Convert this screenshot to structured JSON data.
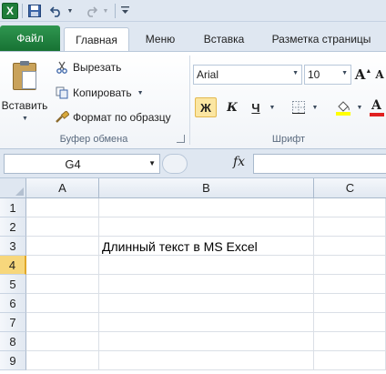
{
  "quick_access": {
    "app_logo_letter": "X",
    "save_icon": "save-icon",
    "undo_icon": "undo-icon",
    "redo_icon": "redo-icon",
    "customize_icon": "customize-qat-icon"
  },
  "tabs": [
    {
      "label": "Файл"
    },
    {
      "label": "Главная"
    },
    {
      "label": "Меню"
    },
    {
      "label": "Вставка"
    },
    {
      "label": "Разметка страницы"
    }
  ],
  "clipboard": {
    "paste_label": "Вставить",
    "cut_label": "Вырезать",
    "copy_label": "Копировать",
    "format_painter_label": "Формат по образцу",
    "group_label": "Буфер обмена"
  },
  "font": {
    "family": "Arial",
    "size": "10",
    "bold_label": "Ж",
    "italic_label": "К",
    "underline_label": "Ч",
    "grow_label": "A",
    "shrink_label": "A",
    "font_color_label": "A",
    "group_label": "Шрифт",
    "bold_active": true
  },
  "formula_bar": {
    "name_box": "G4",
    "fx_label": "fx",
    "formula": ""
  },
  "grid": {
    "columns": [
      "A",
      "B",
      "C"
    ],
    "rows": [
      "1",
      "2",
      "3",
      "4",
      "5",
      "6",
      "7",
      "8",
      "9"
    ],
    "active_row": "4",
    "cells": [
      {
        "ref": "B3",
        "value": "Длинный текст в MS Excel"
      }
    ]
  },
  "colors": {
    "file_tab": "#1f7d3a",
    "active_row_header": "#f7d77c",
    "highlight_bar": "#ffff00",
    "font_color_bar": "#e02020"
  }
}
